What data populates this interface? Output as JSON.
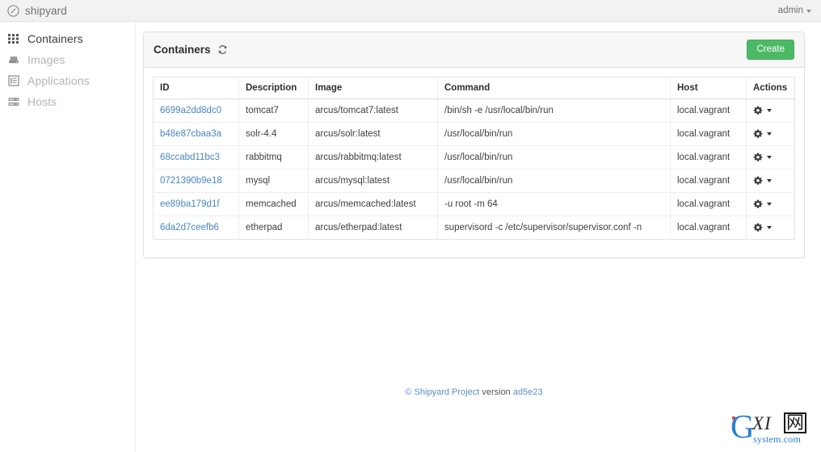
{
  "navbar": {
    "brand": "shipyard",
    "brand_icon": "compass-circle-icon",
    "user": "admin",
    "user_caret_icon": "chevron-down-icon"
  },
  "sidebar": {
    "items": [
      {
        "label": "Containers",
        "icon": "grid-icon",
        "active": true
      },
      {
        "label": "Images",
        "icon": "hard-drive-icon",
        "active": false
      },
      {
        "label": "Applications",
        "icon": "app-window-icon",
        "active": false
      },
      {
        "label": "Hosts",
        "icon": "server-rack-icon",
        "active": false
      }
    ]
  },
  "panel": {
    "title": "Containers",
    "refresh_icon": "refresh-icon",
    "create_label": "Create"
  },
  "table": {
    "columns": [
      "ID",
      "Description",
      "Image",
      "Command",
      "Host",
      "Actions"
    ],
    "action_icons": [
      "gear-icon",
      "chevron-down-icon"
    ],
    "rows": [
      {
        "id": "6699a2dd8dc0",
        "description": "tomcat7",
        "image": "arcus/tomcat7:latest",
        "command": "/bin/sh -e /usr/local/bin/run",
        "host": "local.vagrant"
      },
      {
        "id": "b48e87cbaa3a",
        "description": "solr-4.4",
        "image": "arcus/solr:latest",
        "command": "/usr/local/bin/run",
        "host": "local.vagrant"
      },
      {
        "id": "68ccabd11bc3",
        "description": "rabbitmq",
        "image": "arcus/rabbitmq:latest",
        "command": "/usr/local/bin/run",
        "host": "local.vagrant"
      },
      {
        "id": "0721390b9e18",
        "description": "mysql",
        "image": "arcus/mysql:latest",
        "command": "/usr/local/bin/run",
        "host": "local.vagrant"
      },
      {
        "id": "ee89ba179d1f",
        "description": "memcached",
        "image": "arcus/memcached:latest",
        "command": "-u root -m 64",
        "host": "local.vagrant"
      },
      {
        "id": "6da2d7ceefb6",
        "description": "etherpad",
        "image": "arcus/etherpad:latest",
        "command": "supervisord -c /etc/supervisor/supervisor.conf -n",
        "host": "local.vagrant"
      }
    ]
  },
  "footer": {
    "copyright_symbol": "©",
    "project_link": "Shipyard Project",
    "version_label": "version",
    "version_value": "ad5e23"
  },
  "watermark": {
    "g": "G",
    "xi": "XI",
    "net": "网",
    "system": "system.com"
  },
  "colors": {
    "accent_green": "#4cb964",
    "link_blue": "#4a87c4",
    "navbar_bg": "#f2f2f2",
    "panel_head_bg": "#f7f7f7"
  }
}
